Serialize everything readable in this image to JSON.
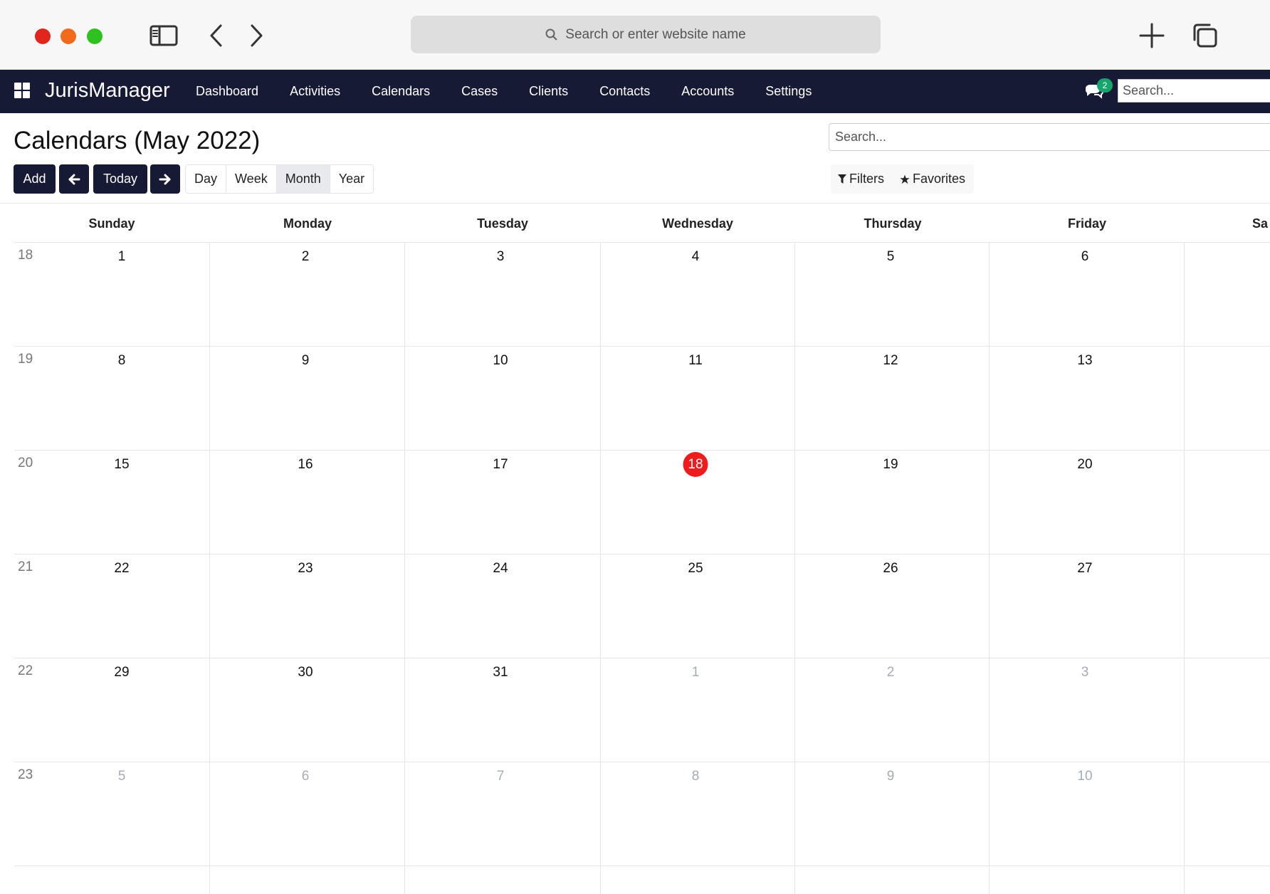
{
  "browser": {
    "address_placeholder": "Search or enter website name"
  },
  "navbar": {
    "brand": "JurisManager",
    "items": [
      {
        "label": "Dashboard"
      },
      {
        "label": "Activities"
      },
      {
        "label": "Calendars"
      },
      {
        "label": "Cases"
      },
      {
        "label": "Clients"
      },
      {
        "label": "Contacts"
      },
      {
        "label": "Accounts"
      },
      {
        "label": "Settings"
      }
    ],
    "chat_count": "2",
    "search_placeholder": "Search..."
  },
  "page": {
    "title": "Calendars (May 2022)",
    "search_placeholder": "Search..."
  },
  "toolbar": {
    "add_label": "Add",
    "today_label": "Today",
    "views": [
      {
        "label": "Day",
        "active": false
      },
      {
        "label": "Week",
        "active": false
      },
      {
        "label": "Month",
        "active": true
      },
      {
        "label": "Year",
        "active": false
      }
    ],
    "filters_label": "Filters",
    "favorites_label": "Favorites"
  },
  "calendar": {
    "day_headers": [
      "Sunday",
      "Monday",
      "Tuesday",
      "Wednesday",
      "Thursday",
      "Friday",
      "Sa"
    ],
    "weeks": [
      {
        "week": "18",
        "days": [
          "1",
          "2",
          "3",
          "4",
          "5",
          "6"
        ],
        "other_month": [
          false,
          false,
          false,
          false,
          false,
          false
        ]
      },
      {
        "week": "19",
        "days": [
          "8",
          "9",
          "10",
          "11",
          "12",
          "13"
        ],
        "other_month": [
          false,
          false,
          false,
          false,
          false,
          false
        ]
      },
      {
        "week": "20",
        "days": [
          "15",
          "16",
          "17",
          "18",
          "19",
          "20"
        ],
        "other_month": [
          false,
          false,
          false,
          false,
          false,
          false
        ]
      },
      {
        "week": "21",
        "days": [
          "22",
          "23",
          "24",
          "25",
          "26",
          "27"
        ],
        "other_month": [
          false,
          false,
          false,
          false,
          false,
          false
        ]
      },
      {
        "week": "22",
        "days": [
          "29",
          "30",
          "31",
          "1",
          "2",
          "3"
        ],
        "other_month": [
          false,
          false,
          false,
          true,
          true,
          true
        ]
      },
      {
        "week": "23",
        "days": [
          "5",
          "6",
          "7",
          "8",
          "9",
          "10"
        ],
        "other_month": [
          true,
          true,
          true,
          true,
          true,
          true
        ]
      }
    ],
    "today": {
      "week_index": 2,
      "day_index": 3
    }
  }
}
